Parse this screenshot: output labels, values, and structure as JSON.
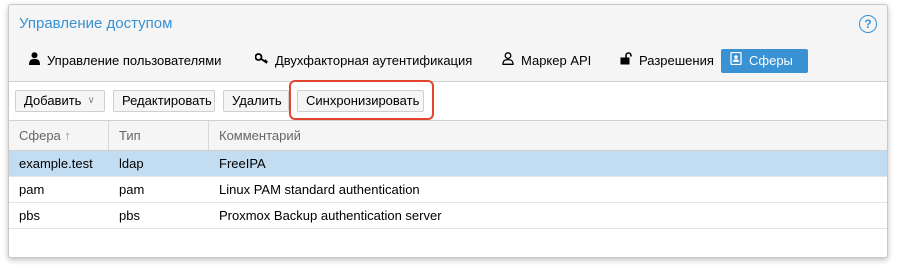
{
  "panel": {
    "title": "Управление доступом",
    "help_icon": "?"
  },
  "tabs": [
    {
      "label": "Управление пользователями",
      "icon": "user-icon"
    },
    {
      "label": "Двухфакторная аутентификация",
      "icon": "key-icon"
    },
    {
      "label": "Маркер API",
      "icon": "user-outline-icon"
    },
    {
      "label": "Разрешения",
      "icon": "unlock-icon"
    },
    {
      "label": "Сферы",
      "icon": "address-book-icon",
      "active": true
    }
  ],
  "toolbar": {
    "add_label": "Добавить",
    "edit_label": "Редактировать",
    "delete_label": "Удалить",
    "sync_label": "Синхронизировать"
  },
  "grid": {
    "columns": [
      "Сфера",
      "Тип",
      "Комментарий"
    ],
    "sort_indicator": "↑",
    "rows": [
      {
        "realm": "example.test",
        "type": "ldap",
        "comment": "FreeIPA",
        "selected": true
      },
      {
        "realm": "pam",
        "type": "pam",
        "comment": "Linux PAM standard authentication"
      },
      {
        "realm": "pbs",
        "type": "pbs",
        "comment": "Proxmox Backup authentication server"
      }
    ]
  },
  "colors": {
    "accent": "#3892d4",
    "selected_row": "#c2ddf2",
    "highlight": "#e2462f"
  }
}
